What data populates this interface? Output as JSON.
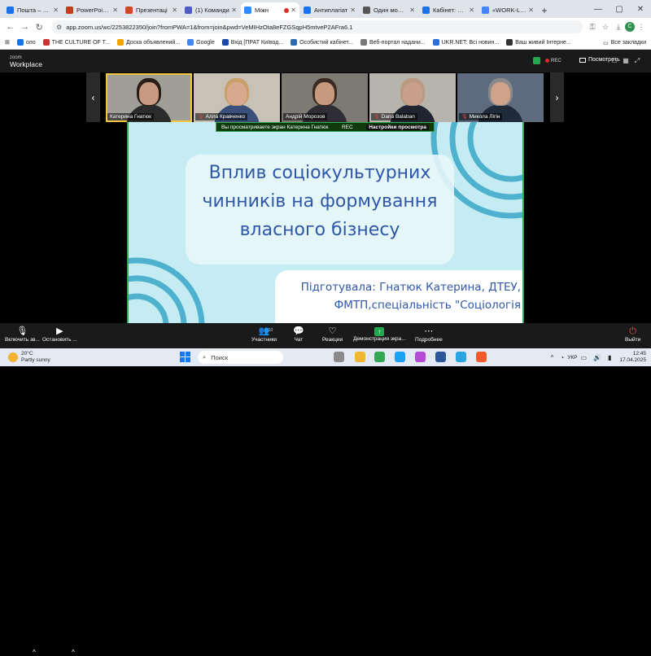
{
  "browser": {
    "tabs": [
      {
        "label": "Пошта – Кра",
        "color": "#1a73e8",
        "active": false
      },
      {
        "label": "PowerPoint |",
        "color": "#c43e1c",
        "active": false
      },
      {
        "label": "Презентаці",
        "color": "#d24726",
        "active": false
      },
      {
        "label": "(1) Команди",
        "color": "#5059c9",
        "active": false
      },
      {
        "label": "Міжн",
        "color": "#2d8cff",
        "active": true
      },
      {
        "label": "Антиплагіат",
        "color": "#1a73e8",
        "active": false
      },
      {
        "label": "Один момен",
        "color": "#555555",
        "active": false
      },
      {
        "label": "Кабінет: Розі",
        "color": "#1a73e8",
        "active": false
      },
      {
        "label": "«WORK-LIFE",
        "color": "#4285f4",
        "active": false
      }
    ],
    "new_tab": "+",
    "url": "app.zoom.us/wc/2253822350/join?fromPWA=1&from=join&pwd=VeMIHzOta8eFZGSqpH5mtveP2AFra6.1",
    "profile_initial": "C",
    "bookmarks": [
      {
        "label": "оло",
        "color": "#1a73e8"
      },
      {
        "label": "THE CULTURE OF T...",
        "color": "#cc3333"
      },
      {
        "label": "Доска объявлений...",
        "color": "#f4a300"
      },
      {
        "label": "Google",
        "color": "#4285f4"
      },
      {
        "label": "Вхід [ПРАТ Київод...",
        "color": "#1a4aa8"
      },
      {
        "label": "Особистий кабінет...",
        "color": "#2b6cb0"
      },
      {
        "label": "Веб-портал надани...",
        "color": "#777777"
      },
      {
        "label": "UKR.NET: Всі новин...",
        "color": "#2a6fdb"
      },
      {
        "label": "Ваш живий Інтерне...",
        "color": "#333333"
      }
    ],
    "all_bookmarks": "Все закладки"
  },
  "zoom": {
    "logo_top": "zoom",
    "logo_bottom": "Workplace",
    "rec_label": "REC",
    "view_label": "Посмотреть",
    "participants": [
      {
        "name": "Катерина Гнатюк",
        "muted": false,
        "speaking": true,
        "bg": "#9f9f98",
        "skin": "#c89a82",
        "hair": "#2b1c14",
        "shirt": "#2b2b2b"
      },
      {
        "name": "Алла Кравченко",
        "muted": true,
        "speaking": false,
        "bg": "#c7c2b5",
        "skin": "#d9a98f",
        "hair": "#c9a06a",
        "shirt": "#3a4f7a"
      },
      {
        "name": "Андрій Морозов",
        "muted": false,
        "speaking": false,
        "bg": "#7d7a73",
        "skin": "#c79a80",
        "hair": "#3a2a1f",
        "shirt": "#2d2d33"
      },
      {
        "name": "Dana Balaban",
        "muted": true,
        "speaking": false,
        "bg": "#b7b4ad",
        "skin": "#c8a08a",
        "hair": "#b89a80",
        "shirt": "#1f2430"
      },
      {
        "name": "Микола Лігін",
        "muted": true,
        "speaking": false,
        "bg": "#5e6b7e",
        "skin": "#cfa28a",
        "hair": "#8a8a8a",
        "shirt": "#1f2a3a"
      }
    ],
    "share_banner": {
      "text": "Вы просматриваете экран  Катерина Гнатюк",
      "rec": "REC",
      "settings": "Настройки просмотра"
    },
    "slide": {
      "title": "Вплив соціокультурних чинників на формування власного бізнесу",
      "author": "Підготувала: Гнатюк Катерина, ДТЕУ, ФМТП,спеціальність \"Соціологія"
    },
    "toolbar": {
      "mic": "Включить зв...",
      "video": "Остановить ...",
      "participants": "Участники",
      "participants_count": "10",
      "chat": "Чат",
      "reactions": "Реакции",
      "share": "Демонстрация экра...",
      "more": "Подробнее",
      "leave": "Выйти"
    }
  },
  "taskbar": {
    "weather_temp": "20°C",
    "weather_desc": "Partly sunny",
    "search": "Поиск",
    "lang": "УКР",
    "time": "12:45",
    "date": "17.04.2025",
    "apps": [
      {
        "name": "task-view",
        "color": "#8a8a8a"
      },
      {
        "name": "explorer",
        "color": "#f2b632"
      },
      {
        "name": "chrome",
        "color": "#34a853"
      },
      {
        "name": "edge",
        "color": "#1da1f2"
      },
      {
        "name": "copilot",
        "color": "#b44cd6"
      },
      {
        "name": "word",
        "color": "#2b579a"
      },
      {
        "name": "telegram",
        "color": "#2aa3df"
      },
      {
        "name": "brave",
        "color": "#ef5b2b"
      }
    ]
  }
}
